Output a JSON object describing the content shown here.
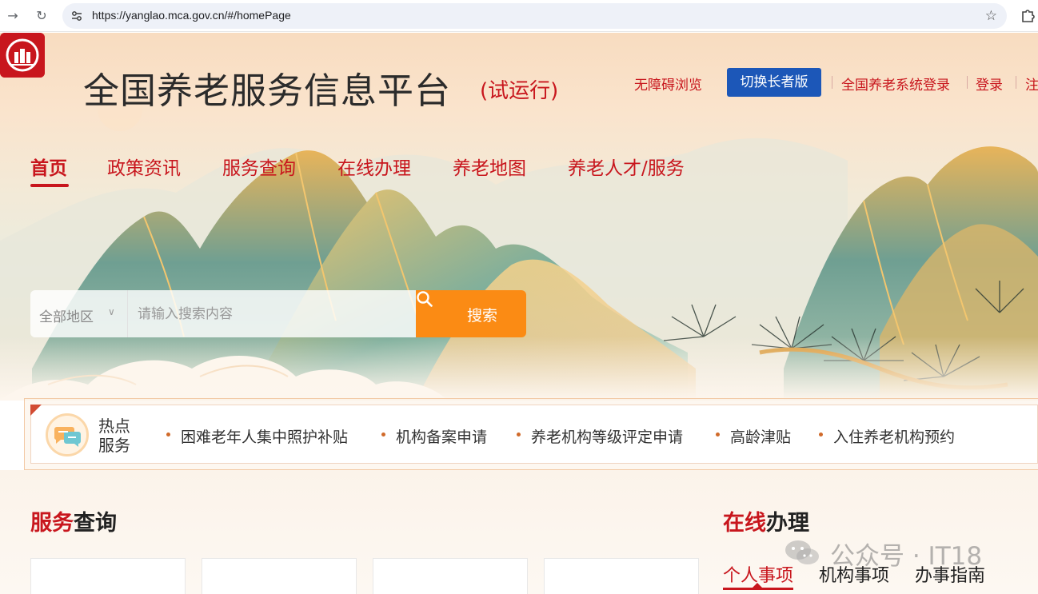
{
  "browser": {
    "url": "https://yanglao.mca.gov.cn/#/homePage",
    "icons": [
      "forward-icon",
      "reload-icon",
      "site-settings-icon",
      "star-icon",
      "extensions-icon"
    ]
  },
  "header": {
    "title": "全国养老服务信息平台",
    "subtitle": "(试运行)",
    "links": {
      "accessible": "无障碍浏览",
      "elder_mode": "切换长者版",
      "system_login": "全国养老系统登录",
      "login": "登录",
      "register_partial": "注"
    }
  },
  "nav": {
    "items": [
      "首页",
      "政策资讯",
      "服务查询",
      "在线办理",
      "养老地图",
      "养老人才/服务"
    ],
    "active": "首页"
  },
  "search": {
    "region": "全部地区",
    "placeholder": "请输入搜索内容",
    "button": "搜索"
  },
  "hot_services": {
    "title": "热点服务",
    "items": [
      "困难老年人集中照护补贴",
      "机构备案申请",
      "养老机构等级评定申请",
      "高龄津贴",
      "入住养老机构预约"
    ]
  },
  "service_query": {
    "title_highlight": "服务",
    "title_rest": "查询"
  },
  "online": {
    "title_highlight": "在线",
    "title_rest": "办理",
    "tabs": [
      "个人事项",
      "机构事项",
      "办事指南"
    ],
    "active_tab": "个人事项"
  },
  "watermark": {
    "text": "公众号 · IT18"
  },
  "colors": {
    "brand_red": "#c8161d",
    "elder_blue": "#1c57b8",
    "search_orange": "#fb8b14"
  }
}
